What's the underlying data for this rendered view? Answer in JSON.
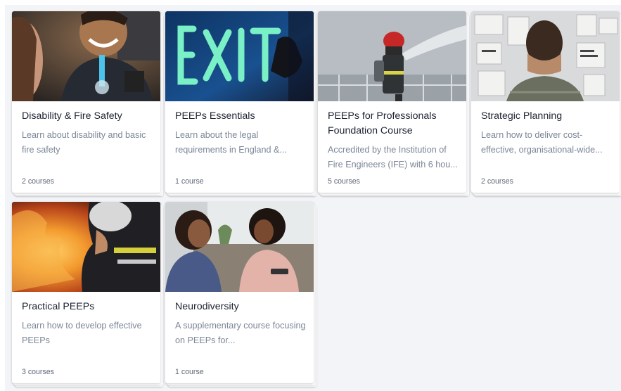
{
  "cards": [
    {
      "title": "Disability & Fire Safety",
      "description": "Learn about disability and basic fire safety",
      "count": "2 courses",
      "image": "two smiling people, one using a wheelchair breathing tube"
    },
    {
      "title": "PEEPs Essentials",
      "description": "Learn about the legal requirements in England &...",
      "count": "1 course",
      "image": "illuminated EXIT sign with hand"
    },
    {
      "title": "PEEPs for Professionals Foundation Course",
      "description": "Accredited by the Institution of Fire Engineers (IFE) with 6 hou...",
      "count": "5 courses",
      "image": "firefighter spraying water hose"
    },
    {
      "title": "Strategic Planning",
      "description": "Learn how to deliver cost-effective, organisational-wide...",
      "count": "2 courses",
      "image": "person viewing planning board"
    },
    {
      "title": "Practical PEEPs",
      "description": "Learn how to develop effective PEEPs",
      "count": "3 courses",
      "image": "firefighter in front of flames"
    },
    {
      "title": "Neurodiversity",
      "description": "A supplementary course focusing on PEEPs for...",
      "count": "1 course",
      "image": "two women talking on a sofa"
    }
  ],
  "colors": {
    "background": "#f3f4f7",
    "title": "#1d2331",
    "description": "#7b8697",
    "count": "#5e6877"
  }
}
